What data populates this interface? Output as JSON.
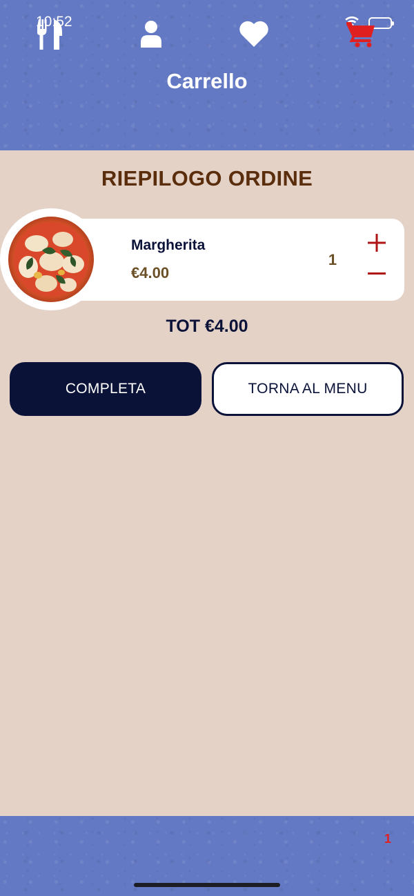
{
  "status_bar": {
    "time": "10:52"
  },
  "header": {
    "title": "Carrello"
  },
  "section_title": "RIEPILOGO ORDINE",
  "cart_items": [
    {
      "name": "Margherita",
      "price": "€4.00",
      "quantity": "1",
      "image": "pizza-margherita"
    }
  ],
  "total": "TOT €4.00",
  "actions": {
    "complete_label": "COMPLETA",
    "back_label": "TORNA AL MENU"
  },
  "tabbar": {
    "items": [
      {
        "icon": "fork-knife-icon",
        "active": false
      },
      {
        "icon": "person-icon",
        "active": false
      },
      {
        "icon": "heart-icon",
        "active": false
      },
      {
        "icon": "cart-icon",
        "active": true
      }
    ],
    "cart_badge": "1"
  },
  "colors": {
    "header_bg": "#6479c3",
    "page_bg": "#e4d2c7",
    "title_brown": "#5a2d0c",
    "navy": "#0b1238",
    "price_brown": "#6b5027",
    "qty_red": "#b01515",
    "active_tab_red": "#e02020"
  }
}
